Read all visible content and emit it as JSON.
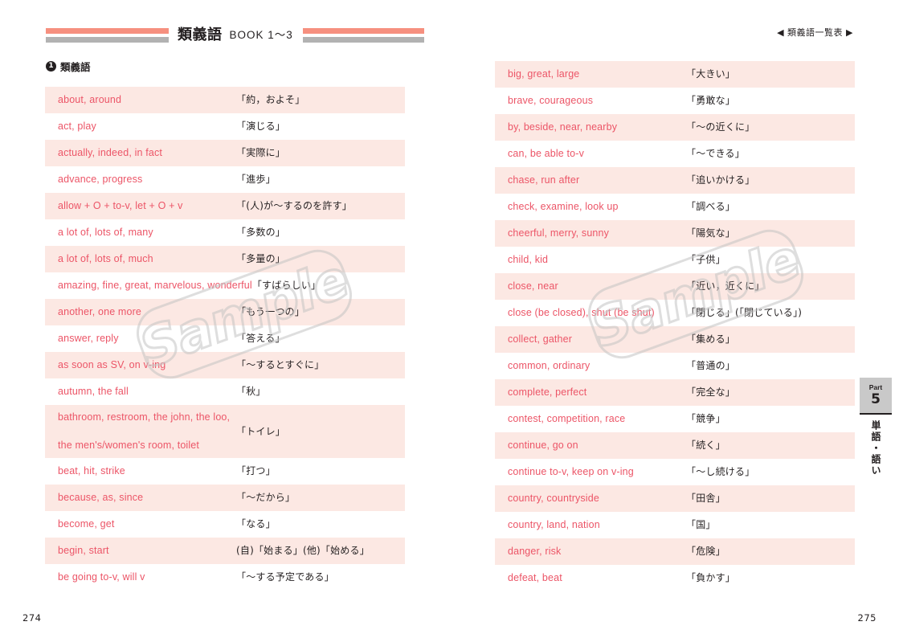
{
  "header": {
    "title_main": "類義語",
    "title_sub": "BOOK 1〜3",
    "running_head": "◀ 類義語一覧表 ▶"
  },
  "section": {
    "number": "1",
    "label": "類義語"
  },
  "side_tab": {
    "part_label": "Part",
    "part_number": "5",
    "vertical_text": "単語・語い"
  },
  "folio": {
    "left": "274",
    "right": "275"
  },
  "watermark": {
    "text": "Sample"
  },
  "colors": {
    "bar_pink": "#f6907f",
    "bar_gray": "#b2b2b2",
    "row_shade": "#fce8e3",
    "english_text": "#ec5567",
    "japanese_text": "#231f20",
    "side_tab_bg": "#c9c9c9"
  },
  "left_column": {
    "rows": [
      {
        "en": [
          "about,  around"
        ],
        "jp": "「約，およそ」",
        "shade": true
      },
      {
        "en": [
          "act,  play"
        ],
        "jp": "「演じる」",
        "shade": false
      },
      {
        "en": [
          "actually,  indeed,  in fact"
        ],
        "jp": "「実際に」",
        "shade": true
      },
      {
        "en": [
          "advance,  progress"
        ],
        "jp": "「進歩」",
        "shade": false
      },
      {
        "en": [
          "allow + O + to-v,  let + O + v"
        ],
        "jp": "「(人)が〜するのを許す」",
        "shade": true
      },
      {
        "en": [
          "a lot of,  lots of,  many"
        ],
        "jp": "「多数の」",
        "shade": false
      },
      {
        "en": [
          "a lot of,  lots of,  much"
        ],
        "jp": "「多量の」",
        "shade": true
      },
      {
        "en": [
          "amazing,  fine,  great,  marvelous,  wonderful"
        ],
        "jp": "「すばらしい」",
        "shade": false
      },
      {
        "en": [
          "another,  one more"
        ],
        "jp": "「もう一つの」",
        "shade": true
      },
      {
        "en": [
          "answer,  reply"
        ],
        "jp": "「答える」",
        "shade": false
      },
      {
        "en": [
          "as soon as SV,  on v-ing"
        ],
        "jp": "「〜するとすぐに」",
        "shade": true
      },
      {
        "en": [
          "autumn,  the fall"
        ],
        "jp": "「秋」",
        "shade": false
      },
      {
        "en": [
          "bathroom,  restroom,  the john,  the loo,",
          "the men's/women's room,  toilet"
        ],
        "jp": "「トイレ」",
        "shade": true,
        "tall": true
      },
      {
        "en": [
          "beat,  hit,  strike"
        ],
        "jp": "「打つ」",
        "shade": false
      },
      {
        "en": [
          "because,  as,  since"
        ],
        "jp": "「〜だから」",
        "shade": true
      },
      {
        "en": [
          "become,  get"
        ],
        "jp": "「なる」",
        "shade": false
      },
      {
        "en": [
          "begin,  start"
        ],
        "jp": "(自)「始まる」(他)「始める」",
        "shade": true
      },
      {
        "en": [
          "be going to-v,  will v"
        ],
        "jp": "「〜する予定である」",
        "shade": false
      }
    ]
  },
  "right_column": {
    "rows": [
      {
        "en": [
          "big,  great,  large"
        ],
        "jp": "「大きい」",
        "shade": true
      },
      {
        "en": [
          "brave,  courageous"
        ],
        "jp": "「勇敢な」",
        "shade": false
      },
      {
        "en": [
          "by,  beside,  near,  nearby"
        ],
        "jp": "「〜の近くに」",
        "shade": true
      },
      {
        "en": [
          "can,  be able to-v"
        ],
        "jp": "「〜できる」",
        "shade": false
      },
      {
        "en": [
          "chase,  run after"
        ],
        "jp": "「追いかける」",
        "shade": true
      },
      {
        "en": [
          "check,  examine,  look up"
        ],
        "jp": "「調べる」",
        "shade": false
      },
      {
        "en": [
          "cheerful,  merry,  sunny"
        ],
        "jp": "「陽気な」",
        "shade": true
      },
      {
        "en": [
          "child,  kid"
        ],
        "jp": "「子供」",
        "shade": false
      },
      {
        "en": [
          "close,  near"
        ],
        "jp": "「近い，近くに」",
        "shade": true
      },
      {
        "en": [
          "close (be closed),  shut (be shut)"
        ],
        "jp": "「閉じる」(「閉じている」)",
        "shade": false
      },
      {
        "en": [
          "collect,  gather"
        ],
        "jp": "「集める」",
        "shade": true
      },
      {
        "en": [
          "common,  ordinary"
        ],
        "jp": "「普通の」",
        "shade": false
      },
      {
        "en": [
          "complete,  perfect"
        ],
        "jp": "「完全な」",
        "shade": true
      },
      {
        "en": [
          "contest,  competition,  race"
        ],
        "jp": "「競争」",
        "shade": false
      },
      {
        "en": [
          "continue,  go on"
        ],
        "jp": "「続く」",
        "shade": true
      },
      {
        "en": [
          "continue to-v,  keep on v-ing"
        ],
        "jp": "「〜し続ける」",
        "shade": false
      },
      {
        "en": [
          "country,  countryside"
        ],
        "jp": "「田舎」",
        "shade": true
      },
      {
        "en": [
          "country,  land,  nation"
        ],
        "jp": "「国」",
        "shade": false
      },
      {
        "en": [
          "danger,  risk"
        ],
        "jp": "「危険」",
        "shade": true
      },
      {
        "en": [
          "defeat,  beat"
        ],
        "jp": "「負かす」",
        "shade": false
      }
    ]
  }
}
